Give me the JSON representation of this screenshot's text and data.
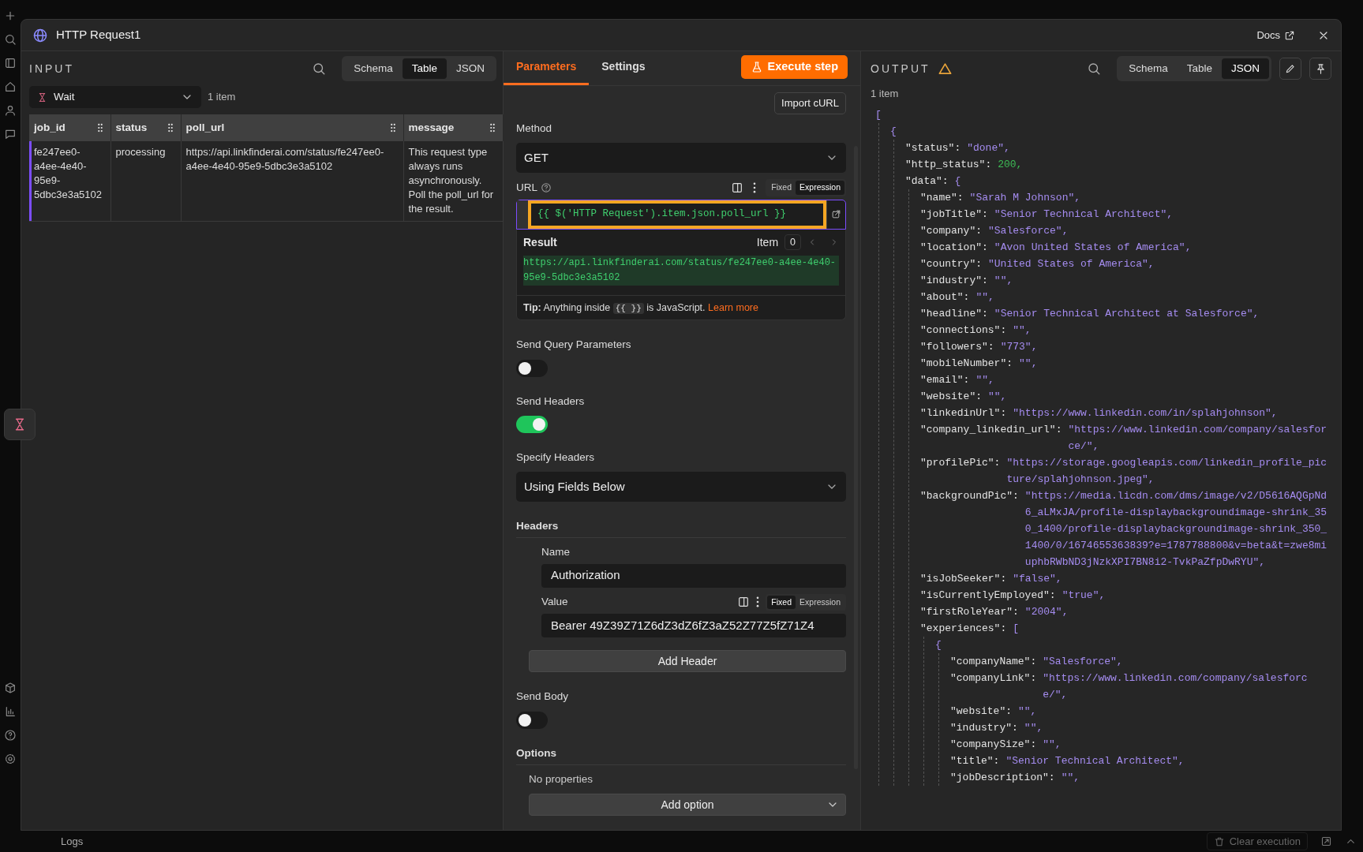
{
  "window": {
    "title": "HTTP Request1",
    "docs_link": "Docs"
  },
  "input_panel": {
    "title": "INPUT",
    "view_tabs": [
      {
        "label": "Schema",
        "selected": false
      },
      {
        "label": "Table",
        "selected": true
      },
      {
        "label": "JSON",
        "selected": false
      }
    ],
    "source_node": "Wait",
    "item_count": "1 item",
    "table": {
      "columns": [
        "job_id",
        "status",
        "poll_url",
        "message"
      ],
      "rows": [
        {
          "selected": true,
          "cells": [
            "fe247ee0-a4ee-4e40-95e9-5dbc3e3a5102",
            "processing",
            "https://api.linkfinderai.com/status/fe247ee0-a4ee-4e40-95e9-5dbc3e3a5102",
            "This request type always runs asynchronously. Poll the poll_url for the result."
          ]
        }
      ]
    }
  },
  "parameters_panel": {
    "tabs": [
      {
        "label": "Parameters",
        "selected": true
      },
      {
        "label": "Settings",
        "selected": false
      }
    ],
    "execute_button": "Execute step",
    "import_button": "Import cURL",
    "method": {
      "label": "Method",
      "value": "GET"
    },
    "url": {
      "label": "URL",
      "modes": [
        {
          "label": "Fixed",
          "selected": false
        },
        {
          "label": "Expression",
          "selected": true
        }
      ],
      "expression": "{{ $('HTTP Request').item.json.poll_url }}",
      "highlighted": true,
      "preview": {
        "label": "Result",
        "item_label": "Item",
        "item_index": "0",
        "result": "https://api.linkfinderai.com/status/fe247ee0-a4ee-4e40-95e9-5dbc3e3a5102",
        "tip_before": "**Tip:** Anything inside",
        "tip_code": "{{ }}",
        "tip_after": "is JavaScript.",
        "tip_link": "Learn more"
      }
    },
    "fields": [
      {
        "kind": "toggle",
        "label": "Send Query Parameters",
        "on": false
      },
      {
        "kind": "toggle",
        "label": "Send Headers",
        "on": true
      },
      {
        "kind": "select",
        "label": "Specify Headers",
        "value": "Using Fields Below"
      },
      {
        "kind": "collection",
        "label": "Headers",
        "entries": [
          {
            "name_label": "Name",
            "name_value": "Authorization",
            "value_label": "Value",
            "modes": [
              {
                "label": "Fixed",
                "selected": true
              },
              {
                "label": "Expression",
                "selected": false
              }
            ],
            "value": "Bearer 49Z39Z71Z6dZ3dZ6fZ3aZ52Z77Z5fZ71Z4"
          }
        ],
        "add_button": "Add Header"
      },
      {
        "kind": "toggle",
        "label": "Send Body",
        "on": false
      },
      {
        "kind": "options",
        "label": "Options",
        "empty_text": "No properties",
        "add_select": "Add option"
      }
    ]
  },
  "output_panel": {
    "title": "OUTPUT",
    "warning": true,
    "view_tabs": [
      {
        "label": "Schema",
        "selected": false
      },
      {
        "label": "Table",
        "selected": false
      },
      {
        "label": "JSON",
        "selected": true
      }
    ],
    "item_count": "1 item",
    "json": {
      "bracket": "[",
      "children": [
        {
          "bracket": "{",
          "children": [
            {
              "key": "\"status\":",
              "value": "\"done\",",
              "kind": "string"
            },
            {
              "key": "\"http_status\":",
              "value": "200,",
              "kind": "number"
            },
            {
              "key": "\"data\":",
              "bracket": "{",
              "children": [
                {
                  "key": "\"name\":",
                  "value": "\"Sarah M Johnson\",",
                  "kind": "string"
                },
                {
                  "key": "\"jobTitle\":",
                  "value": "\"Senior Technical Architect\",",
                  "kind": "string"
                },
                {
                  "key": "\"company\":",
                  "value": "\"Salesforce\",",
                  "kind": "string"
                },
                {
                  "key": "\"location\":",
                  "value": "\"Avon United States of America\",",
                  "kind": "string"
                },
                {
                  "key": "\"country\":",
                  "value": "\"United States of America\",",
                  "kind": "string"
                },
                {
                  "key": "\"industry\":",
                  "value": "\"\",",
                  "kind": "string"
                },
                {
                  "key": "\"about\":",
                  "value": "\"\",",
                  "kind": "string"
                },
                {
                  "key": "\"headline\":",
                  "value": "\"Senior Technical Architect at Salesforce\",",
                  "kind": "string"
                },
                {
                  "key": "\"connections\":",
                  "value": "\"\",",
                  "kind": "string"
                },
                {
                  "key": "\"followers\":",
                  "value": "\"773\",",
                  "kind": "string"
                },
                {
                  "key": "\"mobileNumber\":",
                  "value": "\"\",",
                  "kind": "string"
                },
                {
                  "key": "\"email\":",
                  "value": "\"\",",
                  "kind": "string"
                },
                {
                  "key": "\"website\":",
                  "value": "\"\",",
                  "kind": "string"
                },
                {
                  "key": "\"linkedinUrl\":",
                  "value": "\"https://www.linkedin.com/in/splahjohnson\",",
                  "kind": "string"
                },
                {
                  "key": "\"company_linkedin_url\":",
                  "value": "\"https://www.linkedin.com/company/salesforce/\",",
                  "kind": "string"
                },
                {
                  "key": "\"profilePic\":",
                  "value": "\"https://storage.googleapis.com/linkedin_profile_picture/splahjohnson.jpeg\",",
                  "kind": "string"
                },
                {
                  "key": "\"backgroundPic\":",
                  "value": "\"https://media.licdn.com/dms/image/v2/D5616AQGpNd6_aLMxJA/profile-displaybackgroundimage-shrink_350_1400/profile-displaybackgroundimage-shrink_350_1400/0/1674655363839?e=1787788800&v=beta&t=zwe8miuphbRWbND3jNzkXPI7BN8i2-TvkPaZfpDwRYU\",",
                  "kind": "string"
                },
                {
                  "key": "\"isJobSeeker\":",
                  "value": "\"false\",",
                  "kind": "string"
                },
                {
                  "key": "\"isCurrentlyEmployed\":",
                  "value": "\"true\",",
                  "kind": "string"
                },
                {
                  "key": "\"firstRoleYear\":",
                  "value": "\"2004\",",
                  "kind": "string"
                },
                {
                  "key": "\"experiences\":",
                  "bracket": "[",
                  "children": [
                    {
                      "bracket": "{",
                      "children": [
                        {
                          "key": "\"companyName\":",
                          "value": "\"Salesforce\",",
                          "kind": "string"
                        },
                        {
                          "key": "\"companyLink\":",
                          "value": "\"https://www.linkedin.com/company/salesforce/\",",
                          "kind": "string"
                        },
                        {
                          "key": "\"website\":",
                          "value": "\"\",",
                          "kind": "string"
                        },
                        {
                          "key": "\"industry\":",
                          "value": "\"\",",
                          "kind": "string"
                        },
                        {
                          "key": "\"companySize\":",
                          "value": "\"\",",
                          "kind": "string"
                        },
                        {
                          "key": "\"title\":",
                          "value": "\"Senior Technical Architect\",",
                          "kind": "string"
                        },
                        {
                          "key": "\"jobDescription\":",
                          "value": "\"\",",
                          "kind": "string"
                        }
                      ]
                    }
                  ]
                }
              ]
            }
          ]
        }
      ]
    }
  },
  "bottom_bar": {
    "logs_label": "Logs",
    "clear_button": {
      "label": "Clear execution",
      "disabled": true
    }
  }
}
